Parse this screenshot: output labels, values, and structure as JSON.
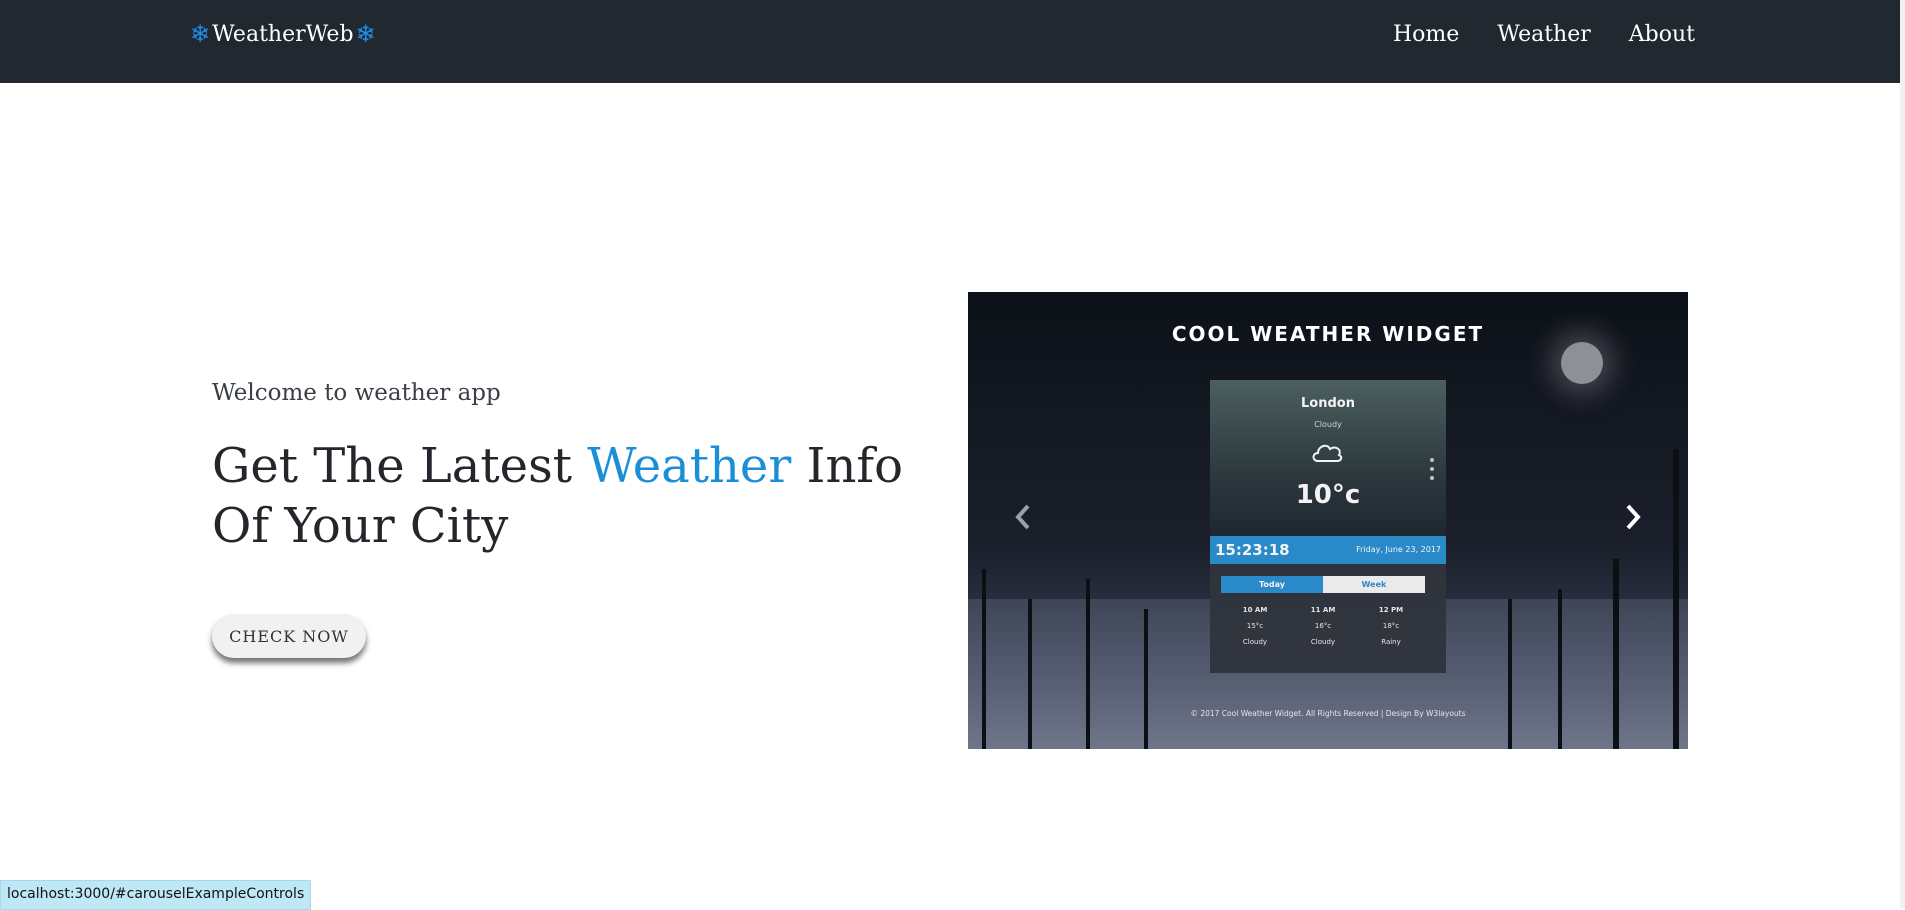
{
  "navbar": {
    "brand": "WeatherWeb",
    "links": [
      "Home",
      "Weather",
      "About"
    ]
  },
  "hero": {
    "welcome": "Welcome to weather app",
    "headline_before": "Get The Latest ",
    "headline_accent": "Weather",
    "headline_after": " Info Of Your City",
    "cta": "CHECK NOW"
  },
  "carousel": {
    "widget_title": "COOL WEATHER WIDGET",
    "city": "London",
    "condition": "Cloudy",
    "temperature": "10°c",
    "time": "15:23:18",
    "date": "Friday, June 23, 2017",
    "tabs": [
      "Today",
      "Week"
    ],
    "forecast": [
      {
        "hour": "10 AM",
        "temp": "15°c",
        "cond": "Cloudy"
      },
      {
        "hour": "11 AM",
        "temp": "16°c",
        "cond": "Cloudy"
      },
      {
        "hour": "12 PM",
        "temp": "18°c",
        "cond": "Rainy"
      }
    ],
    "copyright": "© 2017 Cool Weather Widget. All Rights Reserved | Design By W3layouts"
  },
  "status_bar": "localhost:3000/#carouselExampleControls",
  "colors": {
    "navbar": "#212830",
    "accent": "#1a8fd8",
    "widget_blue": "#2b8fd1"
  }
}
